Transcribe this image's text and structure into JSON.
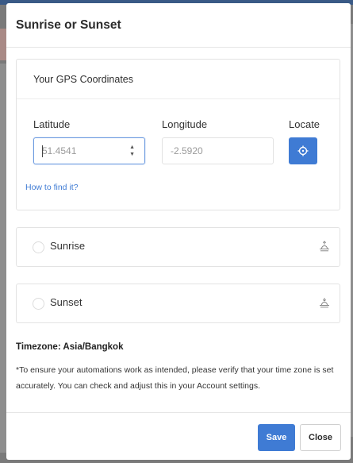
{
  "modal": {
    "title": "Sunrise or Sunset"
  },
  "gps": {
    "title": "Your GPS Coordinates",
    "latitude_label": "Latitude",
    "latitude_value": "51.4541",
    "longitude_label": "Longitude",
    "longitude_value": "-2.5920",
    "locate_label": "Locate",
    "locate_icon": "crosshair-icon",
    "how_to_link": "How to find it?"
  },
  "options": {
    "sunrise": {
      "label": "Sunrise",
      "icon": "sunrise-icon",
      "selected": false
    },
    "sunset": {
      "label": "Sunset",
      "icon": "sunset-icon",
      "selected": false
    }
  },
  "timezone": {
    "label": "Timezone: Asia/Bangkok",
    "note": "*To ensure your automations work as intended, please verify that your time zone is set accurately. You can check and adjust this in your Account settings."
  },
  "footer": {
    "save_label": "Save",
    "close_label": "Close"
  },
  "colors": {
    "accent": "#3f7bd4",
    "border": "#e3e3e3"
  }
}
